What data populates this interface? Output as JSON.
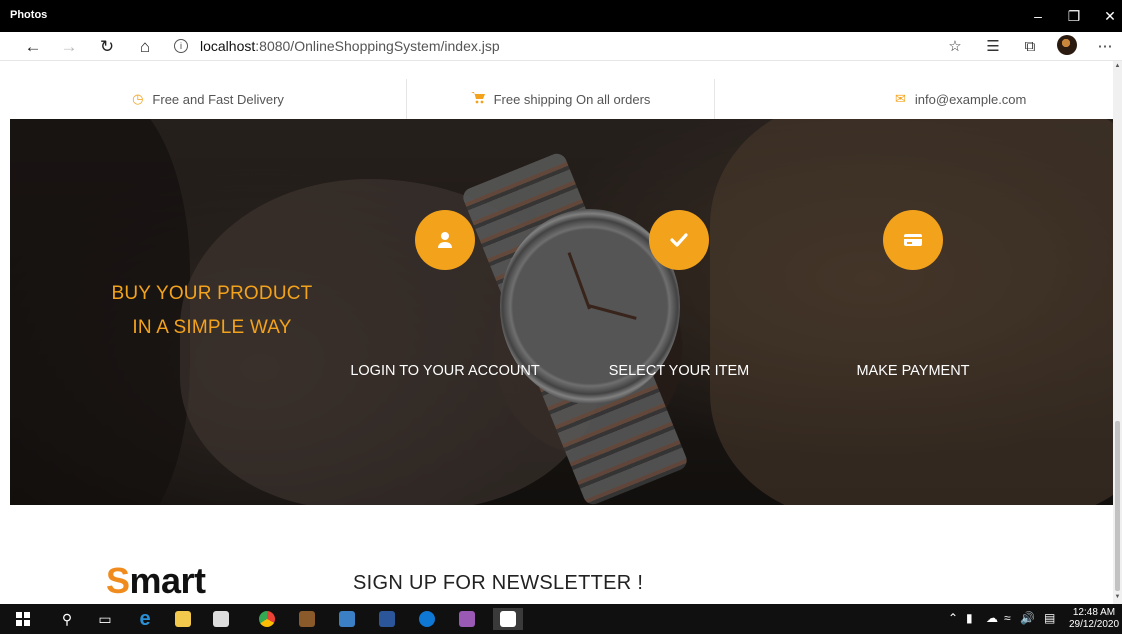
{
  "window": {
    "title": "Photos"
  },
  "browser": {
    "url_host": "localhost",
    "url_path": ":8080/OnlineShoppingSystem/index.jsp"
  },
  "infobar": {
    "items": [
      {
        "label": "Free and Fast Delivery",
        "icon": "clock-icon"
      },
      {
        "label": "Free shipping On all orders",
        "icon": "cart-icon"
      },
      {
        "label": "info@example.com",
        "icon": "envelope-icon"
      }
    ]
  },
  "hero": {
    "tagline_line1": "BUY YOUR PRODUCT",
    "tagline_line2": "IN A SIMPLE WAY",
    "steps": [
      {
        "label": "LOGIN TO YOUR ACCOUNT",
        "icon": "user-icon"
      },
      {
        "label": "SELECT YOUR ITEM",
        "icon": "checkmark-icon"
      },
      {
        "label": "MAKE PAYMENT",
        "icon": "credit-card-icon"
      }
    ]
  },
  "footer": {
    "logo_initial": "S",
    "logo_rest": "mart",
    "newsletter_title": "SIGN UP FOR NEWSLETTER !"
  },
  "taskbar": {
    "clock_time": "12:48 AM",
    "clock_date": "29/12/2020"
  },
  "colors": {
    "accent": "#f3a21c",
    "logo_s": "#f08c1d"
  }
}
